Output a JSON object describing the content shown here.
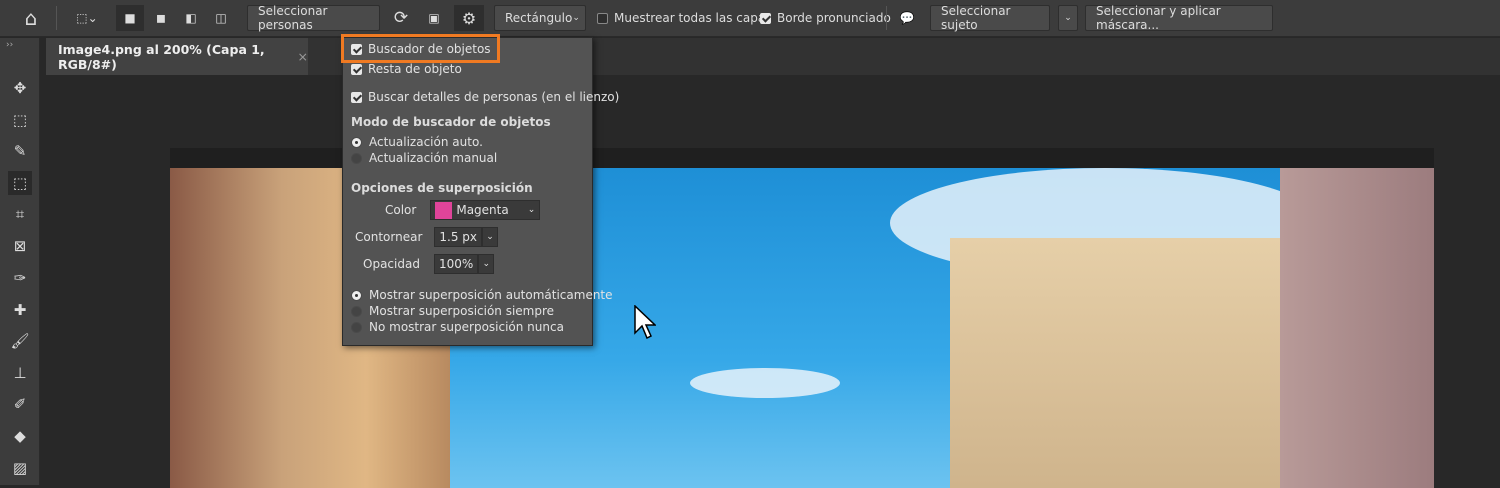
{
  "toolbar": {
    "select_people": "Seleccionar personas",
    "shape": "Rectángulo",
    "sample_all_layers": "Muestrear todas las capas",
    "hard_edge": "Borde pronunciado",
    "select_subject": "Seleccionar sujeto",
    "select_and_mask": "Seleccionar y aplicar máscara..."
  },
  "document_tab": {
    "title": "Image4.png al 200% (Capa 1, RGB/8#)",
    "close": "×"
  },
  "settings_menu": {
    "object_finder": "Buscador de objetos",
    "object_subtract": "Resta de objeto",
    "find_people_details": "Buscar detalles de personas (en el lienzo)",
    "mode_heading": "Modo de buscador de objetos",
    "mode_options": [
      "Actualización auto.",
      "Actualización manual"
    ],
    "overlay_heading": "Opciones de superposición",
    "color_label": "Color",
    "color_value": "Magenta",
    "color_swatch": "#e0449a",
    "outline_label": "Contornear",
    "outline_value": "1.5 px",
    "opacity_label": "Opacidad",
    "opacity_value": "100%",
    "overlay_options": [
      "Mostrar superposición automáticamente",
      "Mostrar superposición siempre",
      "No mostrar superposición nunca"
    ]
  },
  "colors": {
    "highlight": "#f07a22"
  }
}
